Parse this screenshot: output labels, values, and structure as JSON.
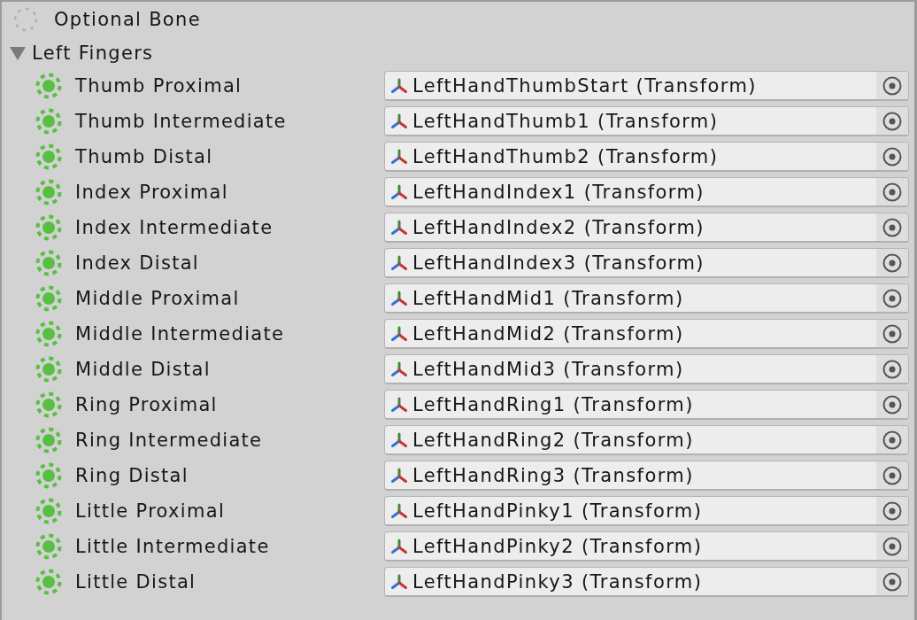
{
  "legend": {
    "label": "Optional Bone"
  },
  "group": {
    "label": "Left Fingers",
    "expanded": true,
    "bones": [
      {
        "name": "Thumb Proximal",
        "value": "LeftHandThumbStart (Transform)"
      },
      {
        "name": "Thumb Intermediate",
        "value": "LeftHandThumb1 (Transform)"
      },
      {
        "name": "Thumb Distal",
        "value": "LeftHandThumb2 (Transform)"
      },
      {
        "name": "Index Proximal",
        "value": "LeftHandIndex1 (Transform)"
      },
      {
        "name": "Index Intermediate",
        "value": "LeftHandIndex2 (Transform)"
      },
      {
        "name": "Index Distal",
        "value": "LeftHandIndex3 (Transform)"
      },
      {
        "name": "Middle Proximal",
        "value": "LeftHandMid1 (Transform)"
      },
      {
        "name": "Middle Intermediate",
        "value": "LeftHandMid2 (Transform)"
      },
      {
        "name": "Middle Distal",
        "value": "LeftHandMid3 (Transform)"
      },
      {
        "name": "Ring Proximal",
        "value": "LeftHandRing1 (Transform)"
      },
      {
        "name": "Ring Intermediate",
        "value": "LeftHandRing2 (Transform)"
      },
      {
        "name": "Ring Distal",
        "value": "LeftHandRing3 (Transform)"
      },
      {
        "name": "Little Proximal",
        "value": "LeftHandPinky1 (Transform)"
      },
      {
        "name": "Little Intermediate",
        "value": "LeftHandPinky2 (Transform)"
      },
      {
        "name": "Little Distal",
        "value": "LeftHandPinky3 (Transform)"
      }
    ]
  }
}
